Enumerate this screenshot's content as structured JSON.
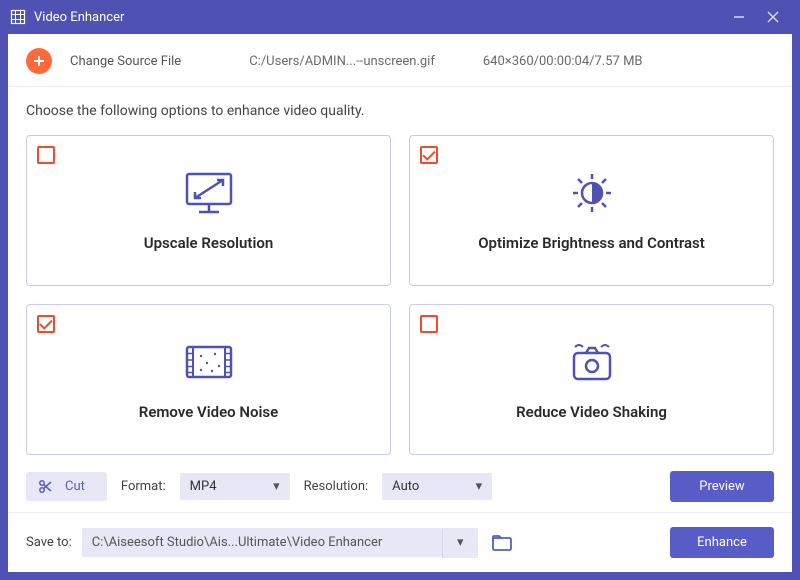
{
  "window": {
    "title": "Video Enhancer"
  },
  "source": {
    "change_label": "Change Source File",
    "path": "C:/Users/ADMIN...--unscreen.gif",
    "info": "640×360/00:00:04/7.57 MB"
  },
  "prompt": "Choose the following options to enhance video quality.",
  "options": {
    "upscale": {
      "label": "Upscale Resolution",
      "checked": false
    },
    "brightness": {
      "label": "Optimize Brightness and Contrast",
      "checked": true
    },
    "noise": {
      "label": "Remove Video Noise",
      "checked": true
    },
    "shaking": {
      "label": "Reduce Video Shaking",
      "checked": false
    }
  },
  "controls": {
    "cut_label": "Cut",
    "format_label": "Format:",
    "format_value": "MP4",
    "resolution_label": "Resolution:",
    "resolution_value": "Auto",
    "preview_label": "Preview"
  },
  "footer": {
    "save_to_label": "Save to:",
    "save_path": "C:\\Aiseesoft Studio\\Ais...Ultimate\\Video Enhancer",
    "enhance_label": "Enhance"
  }
}
